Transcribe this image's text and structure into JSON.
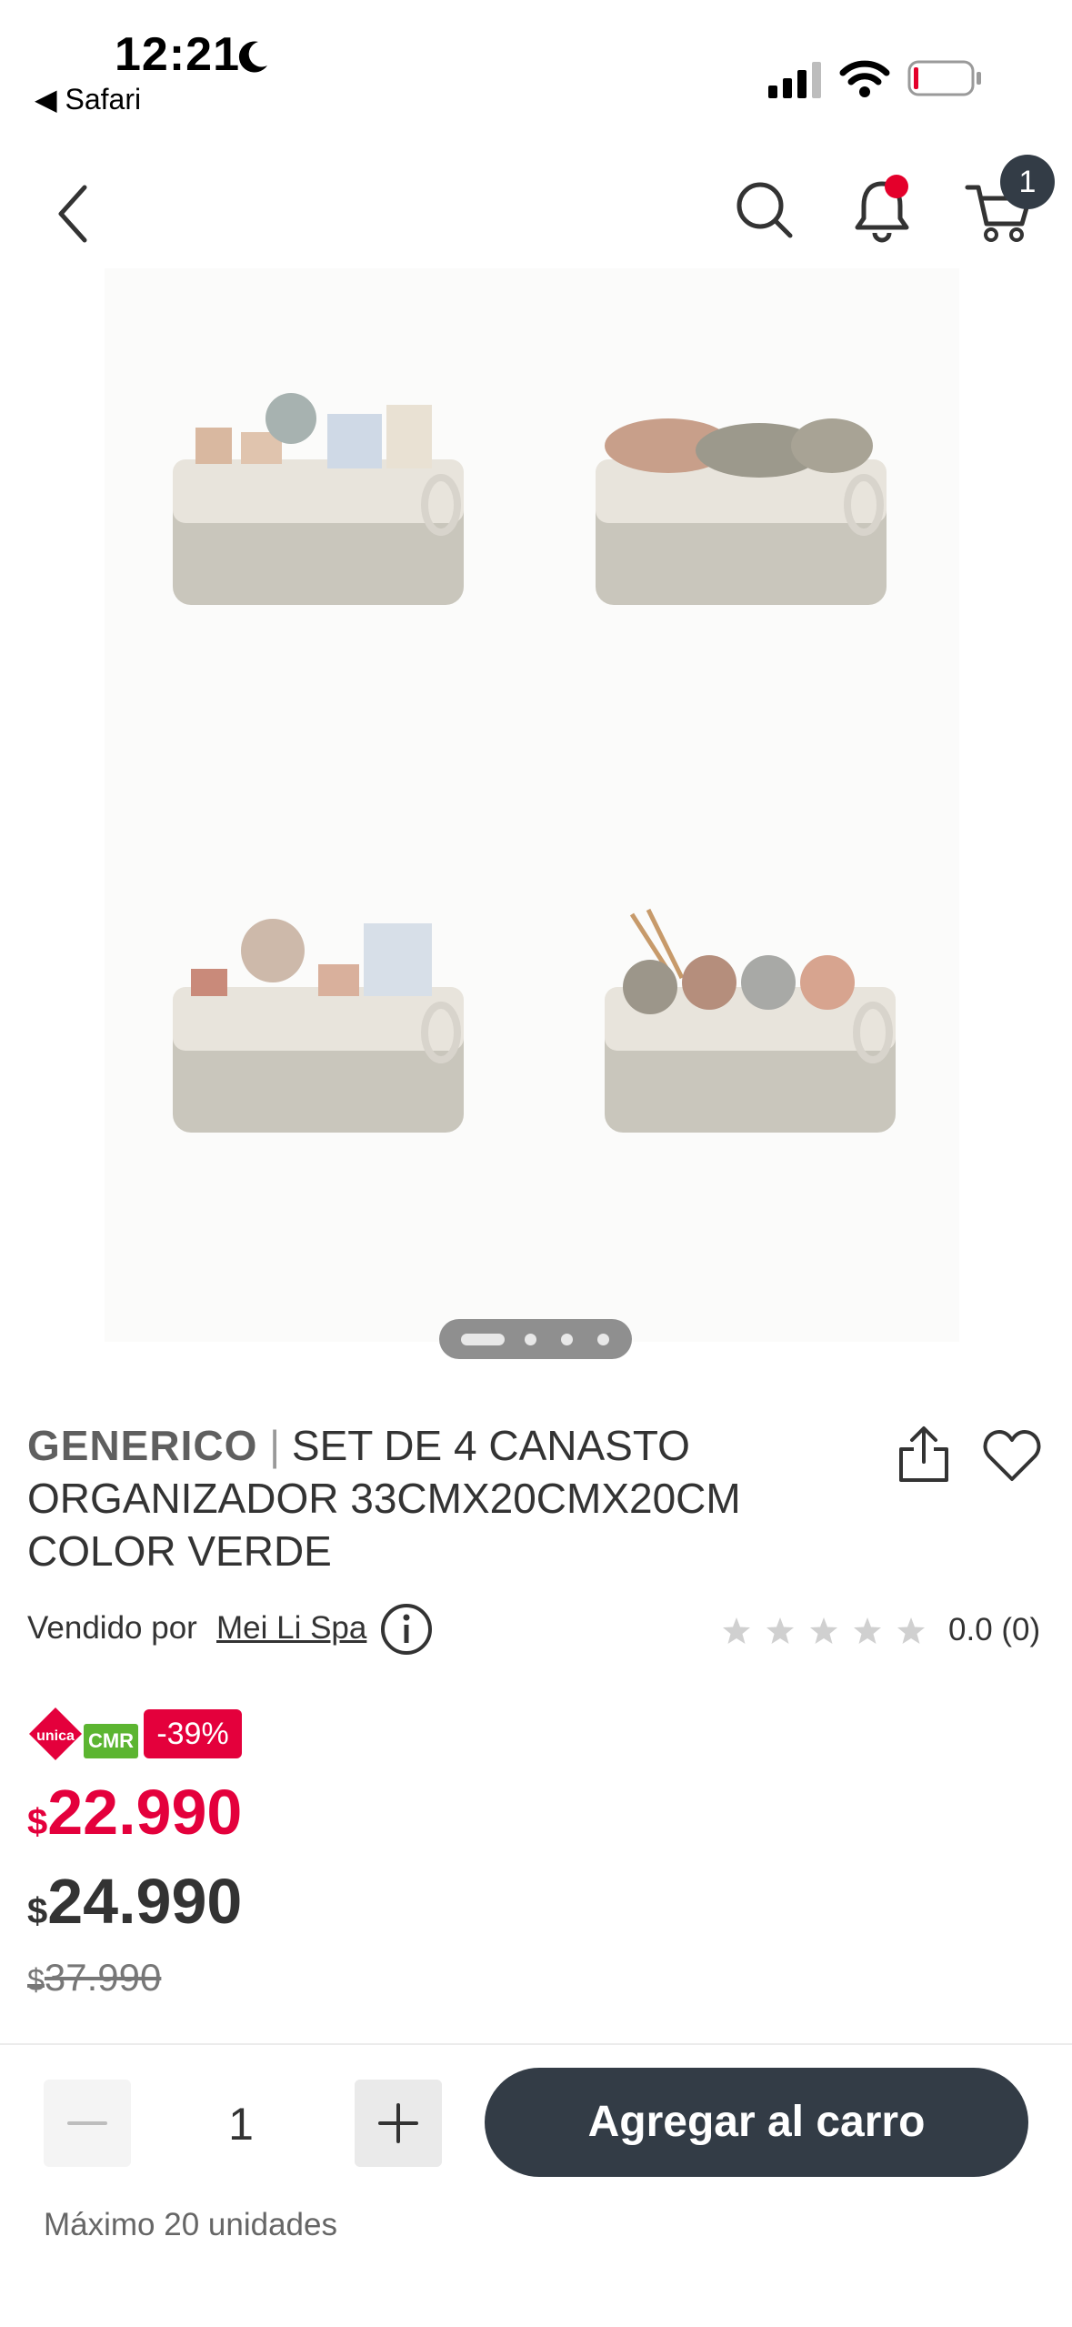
{
  "status_bar": {
    "time": "12:21",
    "back_app": "◀ Safari"
  },
  "nav": {
    "cart_count": "1"
  },
  "gallery": {
    "dots": 4,
    "active_dot": 0
  },
  "product": {
    "brand": "GENERICO",
    "separator": "|",
    "title": "SET DE 4 CANASTO ORGANIZADOR 33CMX20CMX20CM COLOR VERDE",
    "seller_prefix": "Vendido por",
    "seller_name": "Mei Li Spa",
    "rating_text": "0.0 (0)",
    "stars": 0
  },
  "pricing": {
    "unica_label": "unica",
    "cmr_label": "CMR",
    "discount": "-39%",
    "currency": "$",
    "cmr_price": "22.990",
    "price": "24.990",
    "old_price": "37.990"
  },
  "cart_bar": {
    "quantity": "1",
    "add_label": "Agregar al carro",
    "max_label": "Máximo 20 unidades"
  },
  "colors": {
    "accent": "#e4003c",
    "dark": "#333c46",
    "cmr_green": "#5cb531",
    "notification_dot": "#e4002b"
  }
}
